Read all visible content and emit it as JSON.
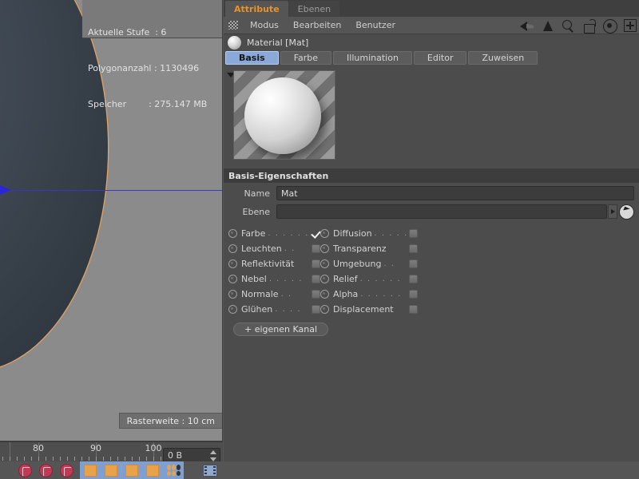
{
  "viewport": {
    "info_panel": {
      "rows": [
        "Aktuelle Stufe  : 6",
        "Polygonanzahl : 1130496",
        "Speicher        : 275.147 MB"
      ]
    },
    "raster_label": "Rasterweite : 10 cm",
    "sphere_outline_color": "#dda45e",
    "sphere_fill_color": "#3d4650",
    "axis_color": "#3a36c8"
  },
  "ruler": {
    "labels": [
      "80",
      "90",
      "100"
    ],
    "label_positions": [
      48,
      120,
      192
    ],
    "major_positions": [
      12,
      48,
      120,
      192
    ],
    "minor_step": 9
  },
  "status_field": {
    "value": "0 B"
  },
  "bottom_toolbar": {
    "items": [
      {
        "name": "undo-view-icon",
        "type": "circle-red"
      },
      {
        "name": "redo-view-icon",
        "type": "circle-red"
      },
      {
        "name": "help-icon",
        "type": "circle-red"
      },
      {
        "name": "move-tool-icon",
        "type": "orange",
        "active": true
      },
      {
        "name": "scale-tool-icon",
        "type": "orange",
        "active": true
      },
      {
        "name": "rotate-tool-icon",
        "type": "orange",
        "active": true
      },
      {
        "name": "render-tool-icon",
        "type": "orange",
        "active": true
      },
      {
        "name": "points-tool-icon",
        "type": "dots",
        "active": true
      },
      {
        "name": "render-view-icon",
        "type": "film"
      }
    ]
  },
  "panel": {
    "tabs": [
      {
        "label": "Attribute",
        "active": true
      },
      {
        "label": "Ebenen",
        "active": false
      }
    ],
    "menu": {
      "hatch_icon": "hatch-grip-icon",
      "items": [
        "Modus",
        "Bearbeiten",
        "Benutzer"
      ],
      "icons": [
        {
          "name": "back-arrow-icon"
        },
        {
          "name": "up-arrow-icon"
        },
        {
          "name": "search-icon"
        },
        {
          "name": "unlock-icon"
        },
        {
          "name": "target-icon"
        },
        {
          "name": "add-box-icon"
        }
      ]
    },
    "material": {
      "title": "Material [Mat]",
      "thumb_icon": "material-sphere-icon",
      "tabs": [
        {
          "label": "Basis",
          "active": true
        },
        {
          "label": "Farbe",
          "active": false
        },
        {
          "label": "Illumination",
          "active": false
        },
        {
          "label": "Editor",
          "active": false
        },
        {
          "label": "Zuweisen",
          "active": false
        }
      ],
      "preview_alt": "material-preview-sphere"
    },
    "basis": {
      "section_title": "Basis-Eigenschaften",
      "name_label": "Name",
      "name_value": "Mat",
      "ebene_label": "Ebene",
      "ebene_value": "",
      "channels": [
        {
          "label": "Farbe",
          "dots": ". . . . . .",
          "checked": true
        },
        {
          "label": "Diffusion",
          "dots": ". . . . .",
          "checked": false
        },
        {
          "label": "Leuchten",
          "dots": ". .",
          "checked": false
        },
        {
          "label": "Transparenz",
          "dots": "",
          "checked": false
        },
        {
          "label": "Reflektivität",
          "dots": "",
          "checked": false
        },
        {
          "label": "Umgebung",
          "dots": ". .",
          "checked": false
        },
        {
          "label": "Nebel",
          "dots": ". . . . .",
          "checked": false
        },
        {
          "label": "Relief",
          "dots": ". . . . . .",
          "checked": false
        },
        {
          "label": "Normale",
          "dots": ". .",
          "checked": false
        },
        {
          "label": "Alpha",
          "dots": ". . . . . .",
          "checked": false
        },
        {
          "label": "Glühen",
          "dots": ". . . .",
          "checked": false
        },
        {
          "label": "Displacement",
          "dots": "",
          "checked": false
        }
      ],
      "own_channel_button": "+ eigenen Kanal"
    }
  }
}
